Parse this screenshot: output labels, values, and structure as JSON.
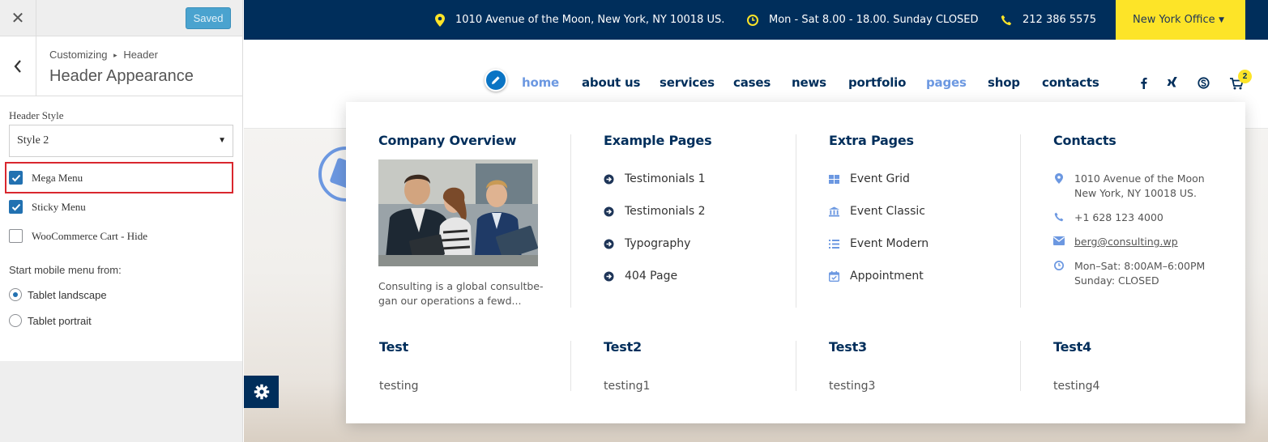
{
  "customizer": {
    "close_icon": "close-icon",
    "saved_label": "Saved",
    "breadcrumb_parent": "Customizing",
    "breadcrumb_separator": "▸",
    "breadcrumb_section": "Header",
    "panel_title": "Header Appearance",
    "header_style_label": "Header  Style",
    "header_style_value": "Style  2",
    "checkboxes": [
      {
        "label": "Mega  Menu",
        "checked": true
      },
      {
        "label": "Sticky  Menu",
        "checked": true
      },
      {
        "label": "WooCommerce  Cart  -  Hide",
        "checked": false
      }
    ],
    "mobile_menu_label": "Start mobile menu from:",
    "radios": [
      {
        "label": "Tablet landscape",
        "selected": true
      },
      {
        "label": "Tablet portrait",
        "selected": false
      }
    ]
  },
  "topbar": {
    "address": "1010 Avenue of the Moon, New York, NY 10018 US.",
    "hours": "Mon - Sat 8.00 - 18.00. Sunday CLOSED",
    "phone": "212 386 5575",
    "office": "New York Office"
  },
  "nav": {
    "links": [
      "home",
      "about us",
      "services",
      "cases",
      "news",
      "portfolio",
      "pages",
      "shop",
      "contacts"
    ],
    "active": [
      "home",
      "pages"
    ],
    "cart_count": "2"
  },
  "mega_menu": {
    "columns": [
      {
        "title": "Company Overview",
        "description": "Consulting is a global consultbe- gan our operations a fewd..."
      },
      {
        "title": "Example Pages",
        "items": [
          "Testimonials 1",
          "Testimonials 2",
          "Typography",
          "404 Page"
        ]
      },
      {
        "title": "Extra Pages",
        "items": [
          "Event Grid",
          "Event Classic",
          "Event Modern",
          "Appointment"
        ]
      },
      {
        "title": "Contacts",
        "address_line1": "1010 Avenue of the Moon",
        "address_line2": "New York, NY 10018 US.",
        "phone": "+1 628 123 4000",
        "email": "berg@consulting.wp",
        "hours_line1": "Mon–Sat: 8:00AM–6:00PM",
        "hours_line2": "Sunday: CLOSED"
      }
    ],
    "second_row": [
      {
        "title": "Test",
        "text": "testing"
      },
      {
        "title": "Test2",
        "text": "testing1"
      },
      {
        "title": "Test3",
        "text": "testing3"
      },
      {
        "title": "Test4",
        "text": "testing4"
      }
    ]
  },
  "colors": {
    "navy": "#002e5b",
    "accent_blue": "#6c98e1",
    "yellow": "#fde428",
    "wp_blue": "#2271b1",
    "highlight_red": "#d9272e"
  }
}
